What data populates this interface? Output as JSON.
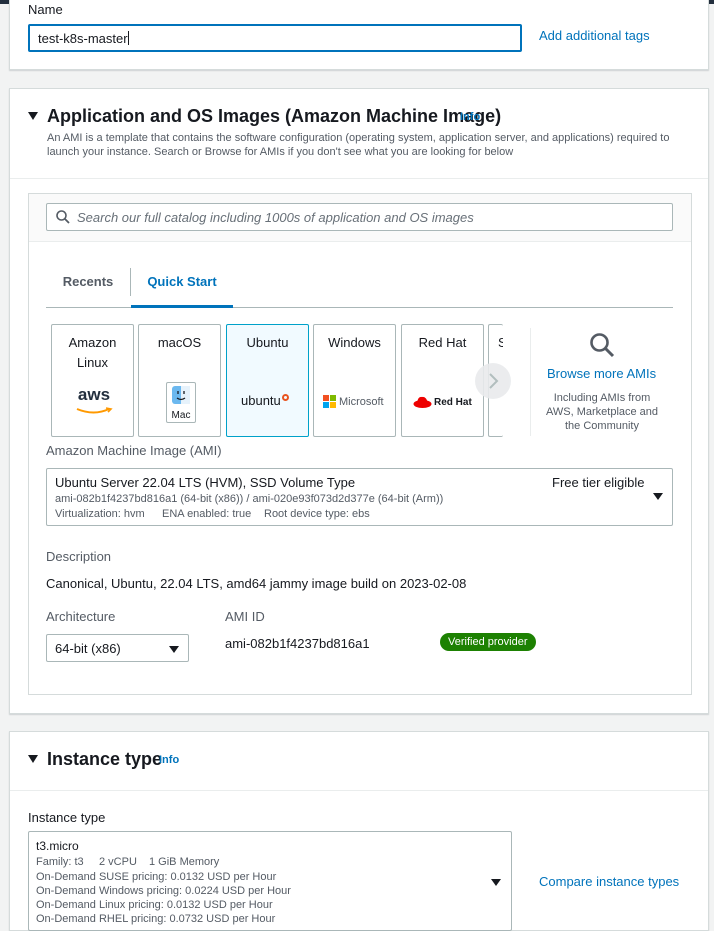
{
  "name_section": {
    "label": "Name",
    "value": "test-k8s-master",
    "add_tags": "Add additional tags"
  },
  "ami_section": {
    "title": "Application and OS Images (Amazon Machine Image)",
    "info": "Info",
    "description": "An AMI is a template that contains the software configuration (operating system, application server, and applications) required to launch your instance. Search or Browse for AMIs if you don't see what you are looking for below",
    "search_placeholder": "Search our full catalog including 1000s of application and OS images",
    "tabs": [
      {
        "label": "Recents",
        "active": false
      },
      {
        "label": "Quick Start",
        "active": true
      }
    ],
    "tiles": [
      {
        "name": "Amazon Linux",
        "logo": "aws"
      },
      {
        "name": "macOS",
        "logo": "Mac"
      },
      {
        "name": "Ubuntu",
        "logo": "ubuntu",
        "selected": true
      },
      {
        "name": "Windows",
        "logo": "Microsoft"
      },
      {
        "name": "Red Hat",
        "logo": "Red Hat"
      },
      {
        "name": "S",
        "logo": ""
      }
    ],
    "browse_more": {
      "label": "Browse more AMIs",
      "sub": "Including AMIs from AWS, Marketplace and the Community"
    },
    "ami_label": "Amazon Machine Image (AMI)",
    "ami_select": {
      "name": "Ubuntu Server 22.04 LTS (HVM), SSD Volume Type",
      "tier": "Free tier eligible",
      "ids": "ami-082b1f4237bd816a1 (64-bit (x86)) / ami-020e93f073d2d377e (64-bit (Arm))",
      "virtualization": "Virtualization: hvm",
      "ena": "ENA enabled: true",
      "root_device": "Root device type: ebs"
    },
    "description_label": "Description",
    "description_value": "Canonical, Ubuntu, 22.04 LTS, amd64 jammy image build on 2023-02-08",
    "architecture_label": "Architecture",
    "architecture_value": "64-bit (x86)",
    "ami_id_label": "AMI ID",
    "ami_id_value": "ami-082b1f4237bd816a1",
    "verified_badge": "Verified provider"
  },
  "instance_section": {
    "title": "Instance type",
    "info": "Info",
    "label": "Instance type",
    "select": {
      "name": "t3.micro",
      "family": "Family: t3",
      "vcpu": "2 vCPU",
      "memory": "1 GiB Memory",
      "suse": "On-Demand SUSE pricing: 0.0132 USD per Hour",
      "windows": "On-Demand Windows pricing: 0.0224 USD per Hour",
      "linux": "On-Demand Linux pricing: 0.0132 USD per Hour",
      "rhel": "On-Demand RHEL pricing: 0.0732 USD per Hour"
    },
    "compare": "Compare instance types"
  },
  "colors": {
    "link": "#0073bb",
    "selected_border": "#00a1c9",
    "badge": "#1d8102",
    "topbar": "#232f3e"
  }
}
